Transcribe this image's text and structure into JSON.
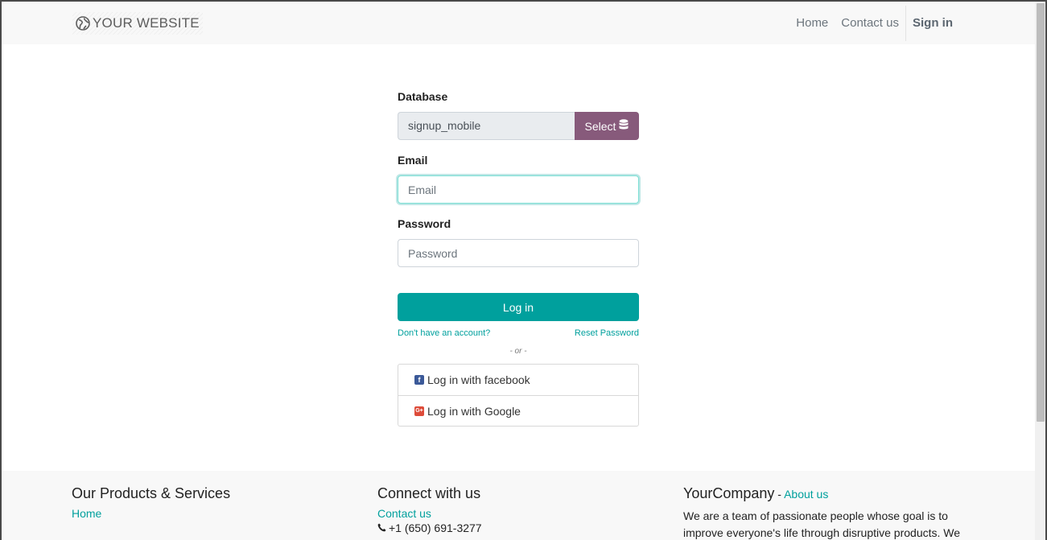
{
  "navbar": {
    "brand": "YOUR WEBSITE",
    "links": [
      "Home",
      "Contact us"
    ],
    "signin": "Sign in"
  },
  "form": {
    "database_label": "Database",
    "database_value": "signup_mobile",
    "select_label": "Select",
    "email_label": "Email",
    "email_placeholder": "Email",
    "password_label": "Password",
    "password_placeholder": "Password",
    "login_label": "Log in",
    "signup_link": "Don't have an account?",
    "reset_link": "Reset Password",
    "or_text": "- or -",
    "oauth": [
      {
        "label": "Log in with facebook",
        "icon": "facebook-icon",
        "color": "#3b5998"
      },
      {
        "label": "Log in with Google",
        "icon": "google-plus-icon",
        "color": "#dd4b39"
      }
    ]
  },
  "footer": {
    "products": {
      "title": "Our Products & Services",
      "link": "Home"
    },
    "connect": {
      "title": "Connect with us",
      "link": "Contact us",
      "phone": "+1 (650) 691-3277"
    },
    "company": {
      "title": "YourCompany",
      "separator": " - ",
      "about": "About us",
      "text": "We are a team of passionate people whose goal is to improve everyone's life through disruptive products. We"
    }
  },
  "colors": {
    "primary": "#00a09d",
    "select": "#875a7b",
    "navbar": "#f8f8f8"
  }
}
